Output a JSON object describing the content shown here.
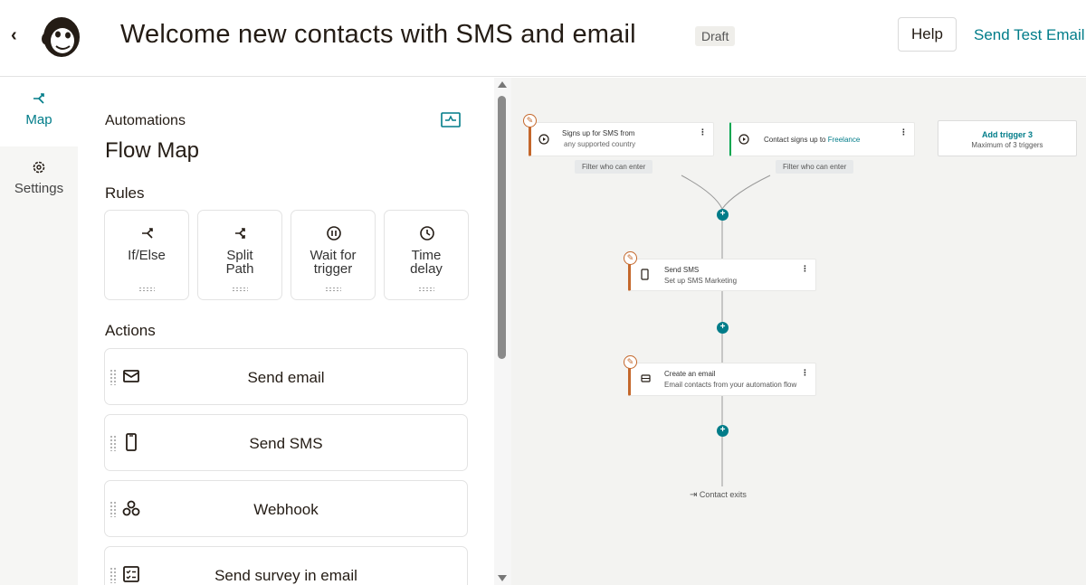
{
  "header": {
    "back_icon": "chevron-left-icon",
    "logo": "mailchimp-freddie-logo",
    "title": "Welcome new contacts with SMS and email",
    "status": "Draft",
    "help_label": "Help",
    "send_test_label": "Send Test Email"
  },
  "nav": {
    "items": [
      {
        "label": "Map",
        "icon": "branch-icon",
        "active": true
      },
      {
        "label": "Settings",
        "icon": "gear-icon",
        "active": false
      }
    ]
  },
  "panel": {
    "breadcrumb": "Automations",
    "title": "Flow Map",
    "rules_heading": "Rules",
    "rules": [
      {
        "label": "If/Else",
        "icon": "branch-icon"
      },
      {
        "label": "Split\nPath",
        "icon": "split-icon"
      },
      {
        "label": "Wait for\ntrigger",
        "icon": "pause-icon"
      },
      {
        "label": "Time\ndelay",
        "icon": "clock-icon"
      }
    ],
    "actions_heading": "Actions",
    "actions": [
      {
        "label": "Send email",
        "icon": "envelope-icon"
      },
      {
        "label": "Send SMS",
        "icon": "phone-icon"
      },
      {
        "label": "Webhook",
        "icon": "webhook-icon"
      },
      {
        "label": "Send survey in email",
        "icon": "survey-icon"
      }
    ]
  },
  "canvas": {
    "trigger1": {
      "line1": "Signs up for SMS from",
      "line2": "any supported country",
      "filter": "Filter who can enter"
    },
    "trigger2": {
      "prefix": "Contact signs up to",
      "link": "Freelance",
      "filter": "Filter who can enter"
    },
    "trigger3": {
      "title": "Add trigger 3",
      "subtitle": "Maximum of 3 triggers"
    },
    "step1": {
      "title": "Send SMS",
      "subtitle": "Set up SMS Marketing"
    },
    "step2": {
      "title": "Create an email",
      "subtitle": "Email contacts from your automation flow"
    },
    "exit": "Contact exits",
    "accent": "#007c89",
    "warning": "#c4672b",
    "active_green": "#00a650"
  }
}
